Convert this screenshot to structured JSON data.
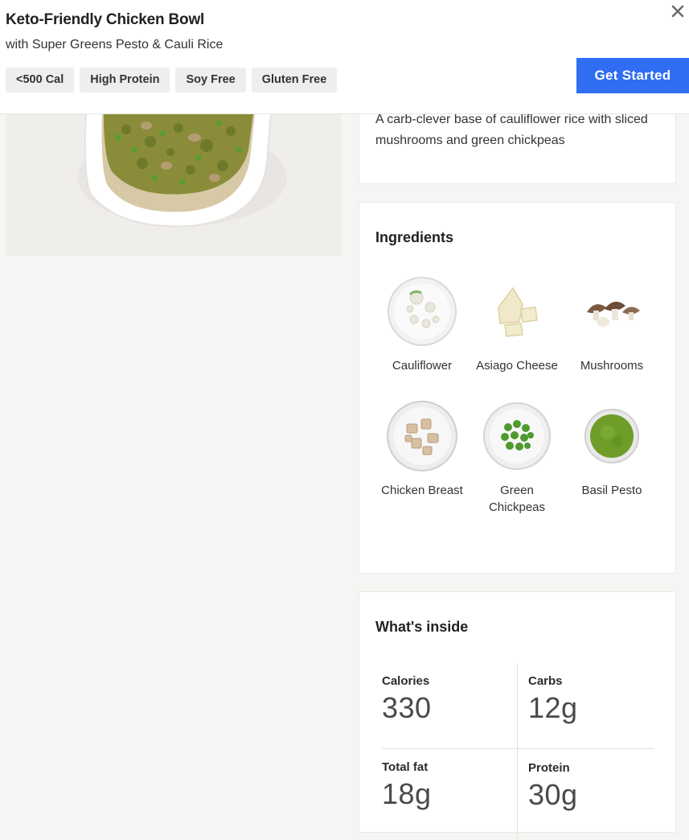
{
  "header": {
    "title": "Keto-Friendly Chicken Bowl",
    "subtitle": "with Super Greens Pesto & Cauli Rice",
    "tags": [
      "<500 Cal",
      "High Protein",
      "Soy Free",
      "Gluten Free"
    ],
    "cta_label": "Get Started",
    "close_icon": "close-icon"
  },
  "description": {
    "text": "A carb-clever base of cauliflower rice with sliced mushrooms and green chickpeas"
  },
  "ingredients": {
    "title": "Ingredients",
    "items": [
      {
        "label": "Cauliflower",
        "icon": "cauliflower-icon"
      },
      {
        "label": "Asiago Cheese",
        "icon": "cheese-icon"
      },
      {
        "label": "Mushrooms",
        "icon": "mushroom-icon"
      },
      {
        "label": "Chicken Breast",
        "icon": "chicken-icon"
      },
      {
        "label": "Green Chickpeas",
        "icon": "chickpeas-icon"
      },
      {
        "label": "Basil Pesto",
        "icon": "pesto-icon"
      }
    ]
  },
  "nutrition": {
    "title": "What's inside",
    "calories": {
      "label": "Calories",
      "value": "330"
    },
    "carbs": {
      "label": "Carbs",
      "value": "12g"
    },
    "fat": {
      "label": "Total fat",
      "value": "18g"
    },
    "protein": {
      "label": "Protein",
      "value": "30g"
    }
  },
  "colors": {
    "accent": "#2f6df2",
    "background": "#f6f5f4",
    "tag_bg": "#efeeec"
  }
}
